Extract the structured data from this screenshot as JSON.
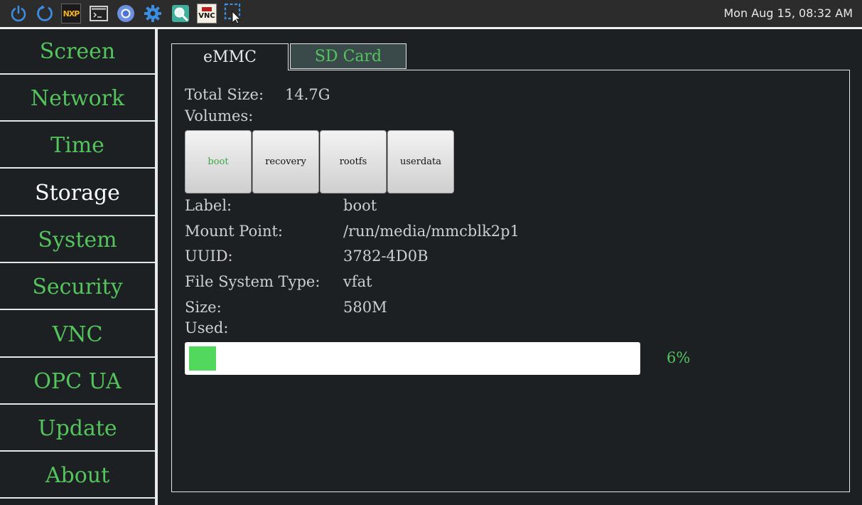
{
  "taskbar": {
    "icons": [
      "power-icon",
      "refresh-icon",
      "nxp-logo-icon",
      "terminal-icon",
      "chromium-icon",
      "settings-gear-icon",
      "search-icon",
      "tightvnc-icon",
      "screenshot-select-icon"
    ],
    "nxp_text": "NXP",
    "vnc_text": "VNC",
    "clock": "Mon Aug 15, 08:32 AM"
  },
  "sidebar": {
    "items": [
      {
        "label": "Screen",
        "active": false
      },
      {
        "label": "Network",
        "active": false
      },
      {
        "label": "Time",
        "active": false
      },
      {
        "label": "Storage",
        "active": true
      },
      {
        "label": "System",
        "active": false
      },
      {
        "label": "Security",
        "active": false
      },
      {
        "label": "VNC",
        "active": false
      },
      {
        "label": "OPC UA",
        "active": false
      },
      {
        "label": "Update",
        "active": false
      },
      {
        "label": "About",
        "active": false
      }
    ]
  },
  "tabs": [
    {
      "label": "eMMC",
      "active": true
    },
    {
      "label": "SD Card",
      "active": false
    }
  ],
  "storage": {
    "total_size_label": "Total Size:",
    "total_size_value": "14.7G",
    "volumes_label": "Volumes:",
    "volumes": [
      {
        "label": "boot",
        "selected": true
      },
      {
        "label": "recovery",
        "selected": false
      },
      {
        "label": "rootfs",
        "selected": false
      },
      {
        "label": "userdata",
        "selected": false
      }
    ],
    "details": [
      {
        "label": "Label:",
        "value": "boot"
      },
      {
        "label": "Mount Point:",
        "value": "/run/media/mmcblk2p1"
      },
      {
        "label": "UUID:",
        "value": "3782-4D0B"
      },
      {
        "label": "File System Type:",
        "value": "vfat"
      },
      {
        "label": "Size:",
        "value": "580M"
      }
    ],
    "used_label": "Used:",
    "used_percent": 6,
    "used_text": "6%"
  },
  "colors": {
    "accent_green": "#54c45c",
    "bar_fill": "#52d95d",
    "background": "#1d2023"
  }
}
